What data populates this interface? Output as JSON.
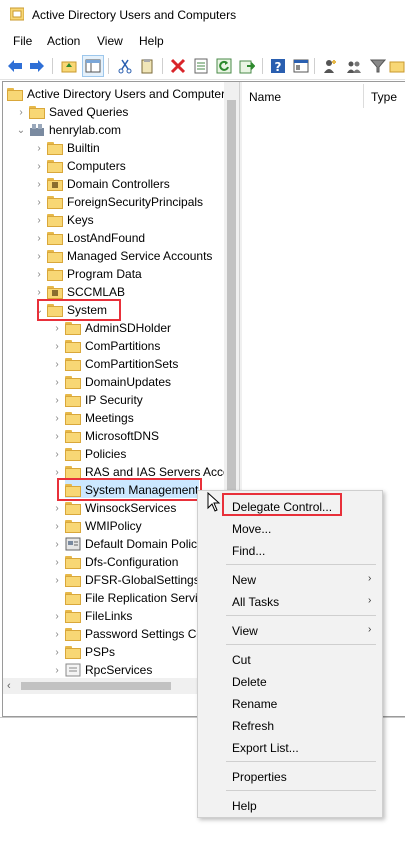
{
  "window": {
    "title": "Active Directory Users and Computers"
  },
  "menubar": {
    "file": "File",
    "action": "Action",
    "view": "View",
    "help": "Help"
  },
  "columns": {
    "name": "Name",
    "type": "Type"
  },
  "tree": {
    "root": "Active Directory Users and Computers",
    "saved_queries": "Saved Queries",
    "domain": "henrylab.com",
    "items": [
      "Builtin",
      "Computers",
      "Domain Controllers",
      "ForeignSecurityPrincipals",
      "Keys",
      "LostAndFound",
      "Managed Service Accounts",
      "Program Data",
      "SCCMLAB",
      "System"
    ],
    "system_children": [
      "AdminSDHolder",
      "ComPartitions",
      "ComPartitionSets",
      "DomainUpdates",
      "IP Security",
      "Meetings",
      "MicrosoftDNS",
      "Policies",
      "RAS and IAS Servers Access Check",
      "System Management",
      "WinsockServices",
      "WMIPolicy",
      "Default Domain Policy",
      "Dfs-Configuration",
      "DFSR-GlobalSettings",
      "File Replication Service",
      "FileLinks",
      "Password Settings Container",
      "PSPs",
      "RpcServices"
    ]
  },
  "context_menu": {
    "delegate": "Delegate Control...",
    "move": "Move...",
    "find": "Find...",
    "new": "New",
    "all_tasks": "All Tasks",
    "view": "View",
    "cut": "Cut",
    "delete": "Delete",
    "rename": "Rename",
    "refresh": "Refresh",
    "export": "Export List...",
    "properties": "Properties",
    "help": "Help"
  },
  "icons": [
    "back-arrow-icon",
    "forward-arrow-icon",
    "up-folder-icon",
    "show-tree-icon",
    "cut-icon",
    "copy-icon",
    "delete-icon",
    "properties-icon",
    "refresh-icon",
    "export-icon",
    "help-icon",
    "mmc-icon",
    "add-user-icon",
    "add-group-icon",
    "filter-icon",
    "add-ou-icon"
  ],
  "colors": {
    "highlight_box": "#e8303a",
    "selection": "#cce8ff",
    "folder": "#f8d775"
  }
}
